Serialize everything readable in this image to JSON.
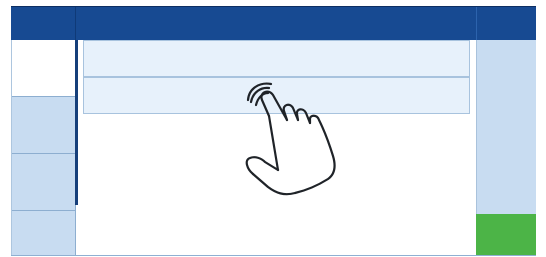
{
  "colors": {
    "header": "#174a92",
    "panel": "#c8dcf1",
    "row": "#e7f1fb",
    "confirm": "#4cb447"
  },
  "icons": {
    "gesture": "tap-hand-icon"
  },
  "list": {
    "rows": [
      "",
      ""
    ]
  }
}
